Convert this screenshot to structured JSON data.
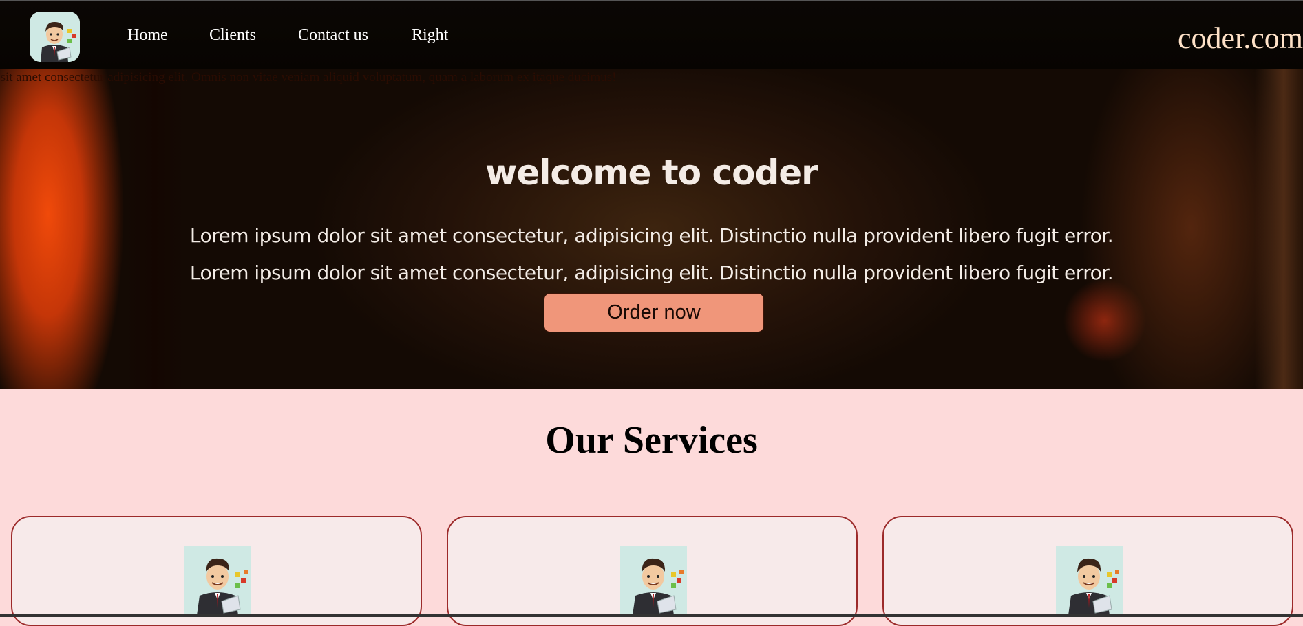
{
  "header": {
    "logo_icon": "cartoon-businessman-logo",
    "nav": [
      {
        "label": "Home"
      },
      {
        "label": "Clients"
      },
      {
        "label": "Contact us"
      },
      {
        "label": "Right"
      }
    ],
    "brand": "coder.com"
  },
  "marquee": {
    "text": "or sit amet consectetur adipisicing elit. Omnis non vitae veniam aliquid voluptatum, quam a laborum ex itaque ducimus!"
  },
  "hero": {
    "title": "welcome to coder",
    "line1": "Lorem ipsum dolor sit amet consectetur, adipisicing elit. Distinctio nulla provident libero fugit error.",
    "line2": "Lorem ipsum dolor sit amet consectetur, adipisicing elit. Distinctio nulla provident libero fugit error.",
    "button_label": "Order now"
  },
  "services": {
    "title": "Our Services",
    "cards": [
      {
        "image_icon": "cartoon-businessman-icon"
      },
      {
        "image_icon": "cartoon-businessman-icon"
      },
      {
        "image_icon": "cartoon-businessman-icon"
      }
    ]
  },
  "colors": {
    "navbar_bg": "#070401",
    "brand_text": "#ffe2c8",
    "button_bg": "#f0967a",
    "services_bg": "#fddada",
    "card_bg": "#f7eaea",
    "card_border": "#9c2a2a"
  }
}
